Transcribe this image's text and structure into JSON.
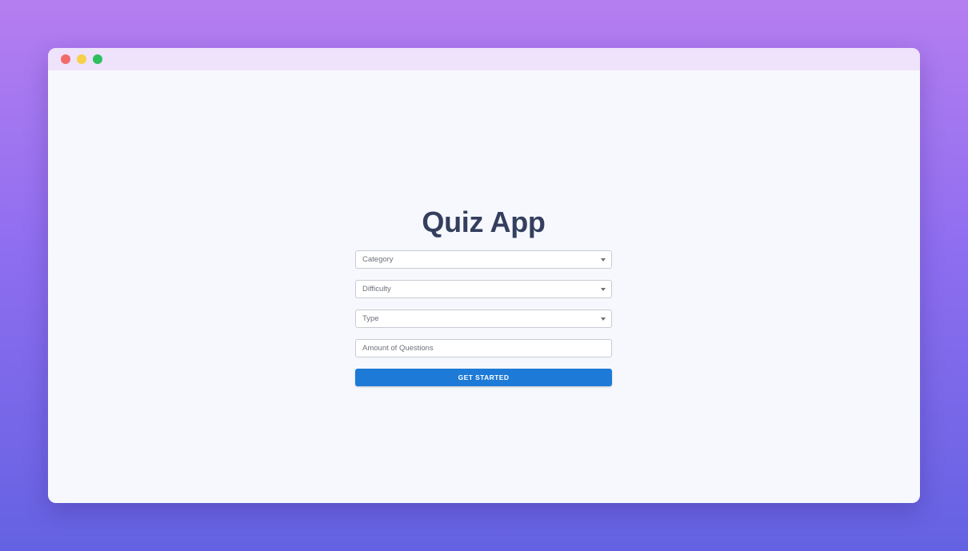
{
  "window": {
    "controls": [
      {
        "name": "close",
        "color": "#f26b6b"
      },
      {
        "name": "minimize",
        "color": "#f6d04a"
      },
      {
        "name": "maximize",
        "color": "#2fbf5e"
      }
    ]
  },
  "app": {
    "title": "Quiz App"
  },
  "form": {
    "category": {
      "label": "Category",
      "icon": "caret-down-icon"
    },
    "difficulty": {
      "label": "Difficulty",
      "icon": "caret-down-icon"
    },
    "type": {
      "label": "Type",
      "icon": "caret-down-icon"
    },
    "amount": {
      "placeholder": "Amount of Questions",
      "value": ""
    },
    "submit_label": "GET STARTED"
  },
  "colors": {
    "accent": "#1d7ad6",
    "title": "#343f5e",
    "window_bg": "#f7f8fd",
    "titlebar_bg": "#efe2fb"
  }
}
